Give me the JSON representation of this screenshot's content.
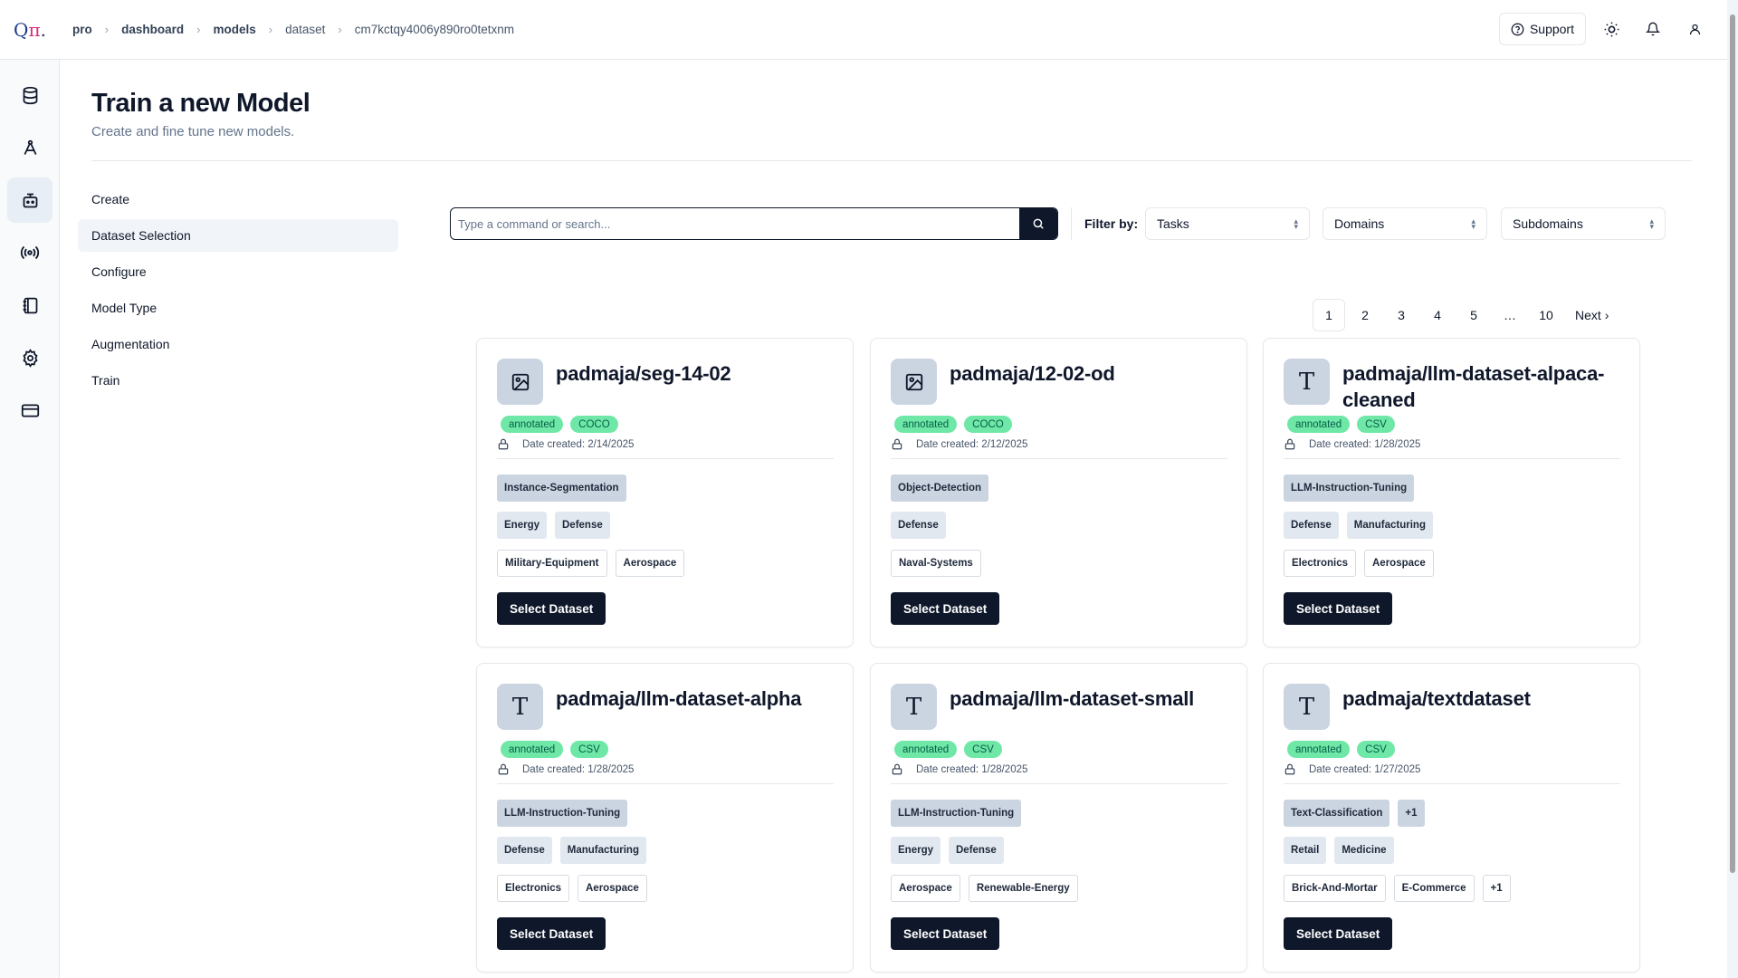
{
  "header": {
    "logo_text": "Qπ.",
    "breadcrumb": [
      "pro",
      "dashboard",
      "models",
      "dataset",
      "cm7kctqy4006y890ro0tetxnm"
    ],
    "support_label": "Support"
  },
  "page": {
    "title": "Train a new Model",
    "subtitle": "Create and fine tune new models."
  },
  "steps": [
    "Create",
    "Dataset Selection",
    "Configure",
    "Model Type",
    "Augmentation",
    "Train"
  ],
  "active_step": "Dataset Selection",
  "search": {
    "placeholder": "Type a command or search..."
  },
  "filters": {
    "label": "Filter by:",
    "tasks": "Tasks",
    "domains": "Domains",
    "subdomains": "Subdomains"
  },
  "pagination": {
    "pages": [
      "1",
      "2",
      "3",
      "4",
      "5",
      "…",
      "10"
    ],
    "current": "1",
    "next_label": "Next"
  },
  "cards": [
    {
      "title": "padmaja/seg-14-02",
      "icon": "image-icon",
      "badges": [
        "annotated",
        "COCO"
      ],
      "date": "Date created: 2/14/2025",
      "tasks": [
        "Instance-Segmentation"
      ],
      "domains": [
        "Energy",
        "Defense"
      ],
      "subdomains": [
        "Military-Equipment",
        "Aerospace"
      ],
      "button": "Select Dataset"
    },
    {
      "title": "padmaja/12-02-od",
      "icon": "image-icon",
      "badges": [
        "annotated",
        "COCO"
      ],
      "date": "Date created: 2/12/2025",
      "tasks": [
        "Object-Detection"
      ],
      "domains": [
        "Defense"
      ],
      "subdomains": [
        "Naval-Systems"
      ],
      "button": "Select Dataset"
    },
    {
      "title": "padmaja/llm-dataset-alpaca-cleaned",
      "icon": "text-icon",
      "badges": [
        "annotated",
        "CSV"
      ],
      "date": "Date created: 1/28/2025",
      "tasks": [
        "LLM-Instruction-Tuning"
      ],
      "domains": [
        "Defense",
        "Manufacturing"
      ],
      "subdomains": [
        "Electronics",
        "Aerospace"
      ],
      "button": "Select Dataset"
    },
    {
      "title": "padmaja/llm-dataset-alpha",
      "icon": "text-icon",
      "badges": [
        "annotated",
        "CSV"
      ],
      "date": "Date created: 1/28/2025",
      "tasks": [
        "LLM-Instruction-Tuning"
      ],
      "domains": [
        "Defense",
        "Manufacturing"
      ],
      "subdomains": [
        "Electronics",
        "Aerospace"
      ],
      "button": "Select Dataset"
    },
    {
      "title": "padmaja/llm-dataset-small",
      "icon": "text-icon",
      "badges": [
        "annotated",
        "CSV"
      ],
      "date": "Date created: 1/28/2025",
      "tasks": [
        "LLM-Instruction-Tuning"
      ],
      "domains": [
        "Energy",
        "Defense"
      ],
      "subdomains": [
        "Aerospace",
        "Renewable-Energy"
      ],
      "button": "Select Dataset"
    },
    {
      "title": "padmaja/textdataset",
      "icon": "text-icon",
      "badges": [
        "annotated",
        "CSV"
      ],
      "date": "Date created: 1/27/2025",
      "tasks": [
        "Text-Classification",
        "+1"
      ],
      "domains": [
        "Retail",
        "Medicine"
      ],
      "subdomains": [
        "Brick-And-Mortar",
        "E-Commerce",
        "+1"
      ],
      "button": "Select Dataset"
    }
  ],
  "colors": {
    "primary": "#0f172a",
    "badge": "#6ee7a7",
    "task_tag": "#cbd5e1",
    "domain_tag": "#e2e8f0"
  }
}
